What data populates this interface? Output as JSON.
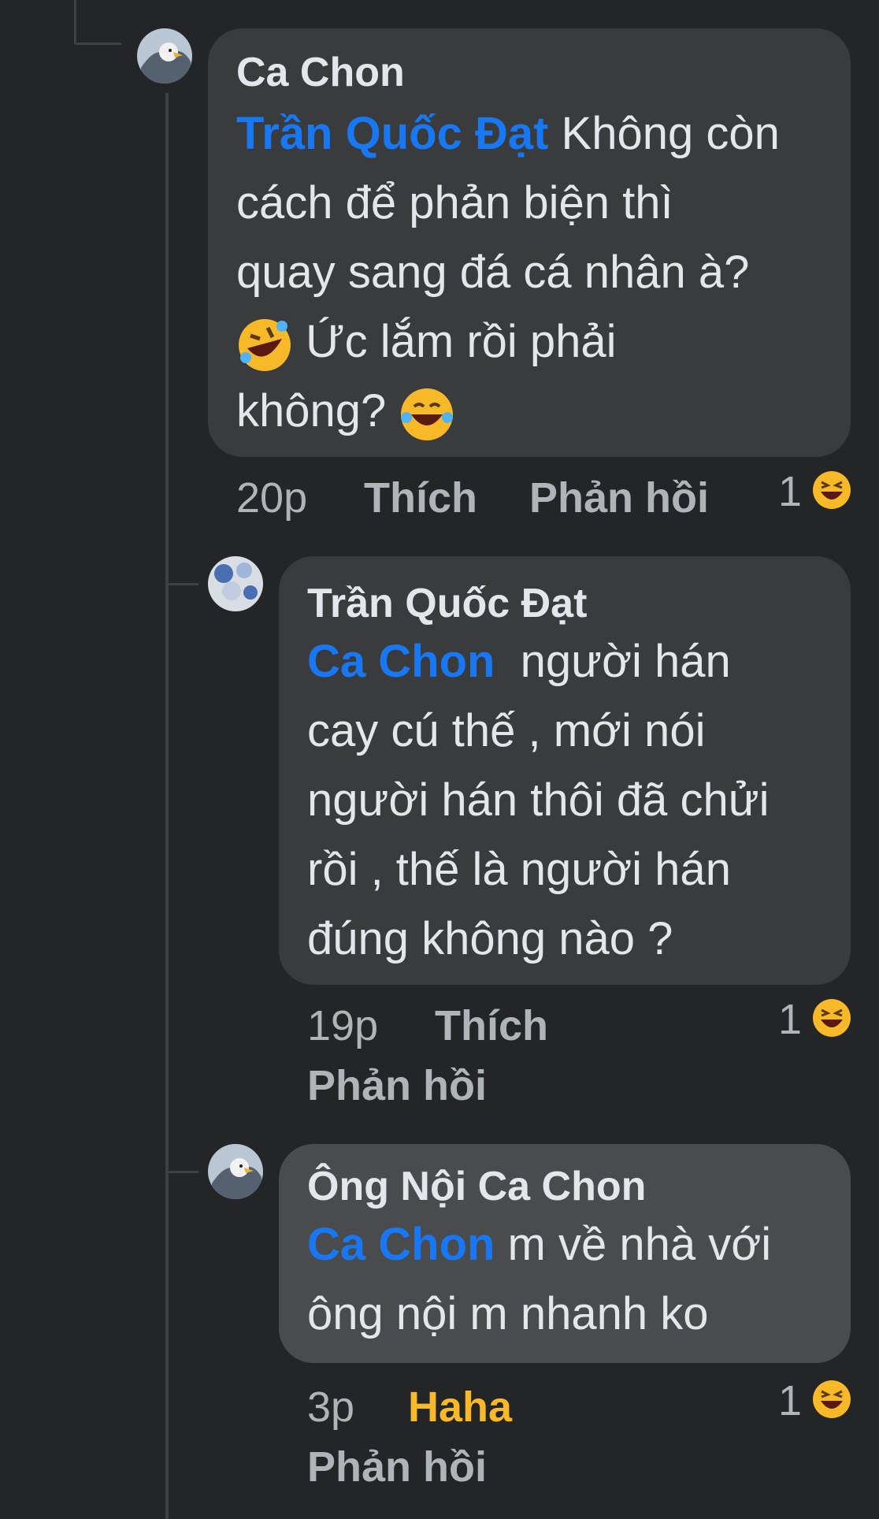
{
  "comments": [
    {
      "author": "Ca Chon",
      "mention": "Trần Quốc Đạt",
      "line1_rest": " Không còn",
      "line2": "cách để phản biện thì",
      "line3": "quay sang đá cá nhân à?",
      "line4": " Ức lắm rồi phải",
      "line5": "không? ",
      "emoji_a": "rolling-on-floor-laughing",
      "emoji_b": "face-with-tears-of-joy",
      "time": "20p",
      "like_label": "Thích",
      "reply_label": "Phản hồi",
      "reaction_count": "1",
      "reaction_icon": "laughing-face-icon"
    },
    {
      "author": "Trần Quốc Đạt",
      "mention": "Ca Chon",
      "line1_rest": "  người hán",
      "line2": "cay cú thế , mới nói",
      "line3": "người hán thôi đã chửi",
      "line4": "rồi , thế là người hán",
      "line5": "đúng không nào ?",
      "time": "19p",
      "like_label": "Thích",
      "reply_label": "Phản hồi",
      "reaction_count": "1",
      "reaction_icon": "laughing-face-icon"
    },
    {
      "author": "Ông Nội Ca Chon",
      "mention": "Ca Chon",
      "line1_rest": " m về nhà với",
      "line2": "ông nội m nhanh ko",
      "time": "3p",
      "like_label": "Haha",
      "reply_label": "Phản hồi",
      "reaction_count": "1",
      "reaction_icon": "laughing-face-icon"
    }
  ],
  "colors": {
    "background": "#242527",
    "bubble": "#3a3b3c",
    "mention": "#1877f2",
    "haha": "#f7b928",
    "meta": "#b0b3b8"
  }
}
